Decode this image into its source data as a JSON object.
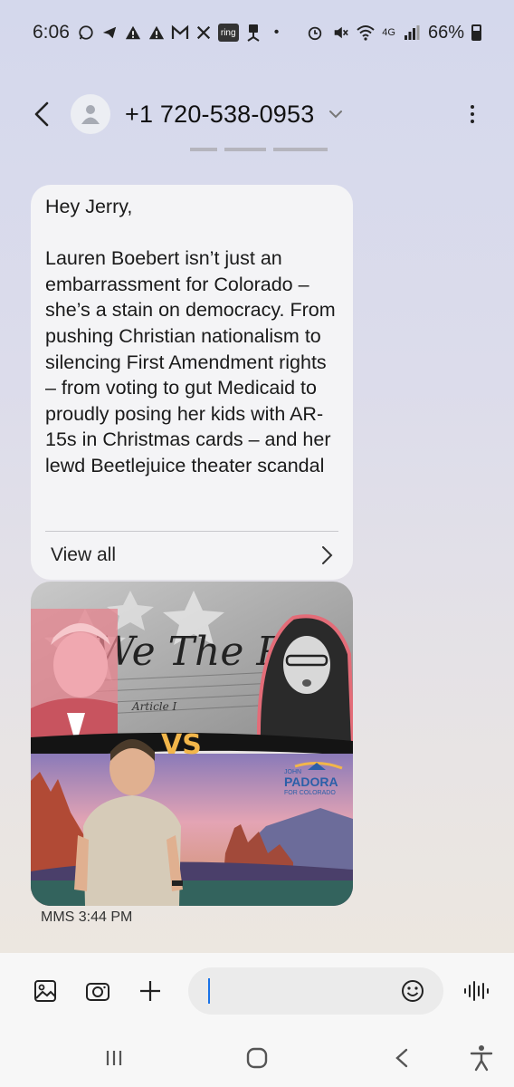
{
  "status_bar": {
    "time": "6:06",
    "battery": "66%",
    "network": "4G",
    "left_icons": [
      "whatsapp-icon",
      "telegram-icon",
      "alert-icon",
      "alert-icon",
      "gmail-icon",
      "x-icon",
      "ring-icon",
      "chair-icon",
      "dot-icon"
    ],
    "ring_label": "ring",
    "right_icons": [
      "alarm-icon",
      "mute-icon",
      "wifi-icon",
      "signal-icon",
      "battery-icon"
    ]
  },
  "header": {
    "contact": "+1 720-538-0953"
  },
  "message": {
    "text": "Hey Jerry,\n\nLauren Boebert isn’t just an embarrassment for Colorado – she’s a stain on democracy. From pushing Christian nationalism to silencing First Amendment rights – from voting to gut Medicaid to proudly posing her kids with AR-15s in Christmas cards – and her lewd Beetlejuice theater scandal",
    "view_all": "View all"
  },
  "image": {
    "text_we_the_people": "We The Peo",
    "article": "Article I",
    "vs": "VS",
    "brand_top": "JOHN",
    "brand_name": "PADORA",
    "brand_bottom": "FOR COLORADO"
  },
  "meta": {
    "label": "MMS 3:44 PM"
  },
  "input": {
    "value": "",
    "placeholder": ""
  },
  "colors": {
    "accent": "#1a73e8",
    "brand_blue": "#2b5fa8"
  }
}
